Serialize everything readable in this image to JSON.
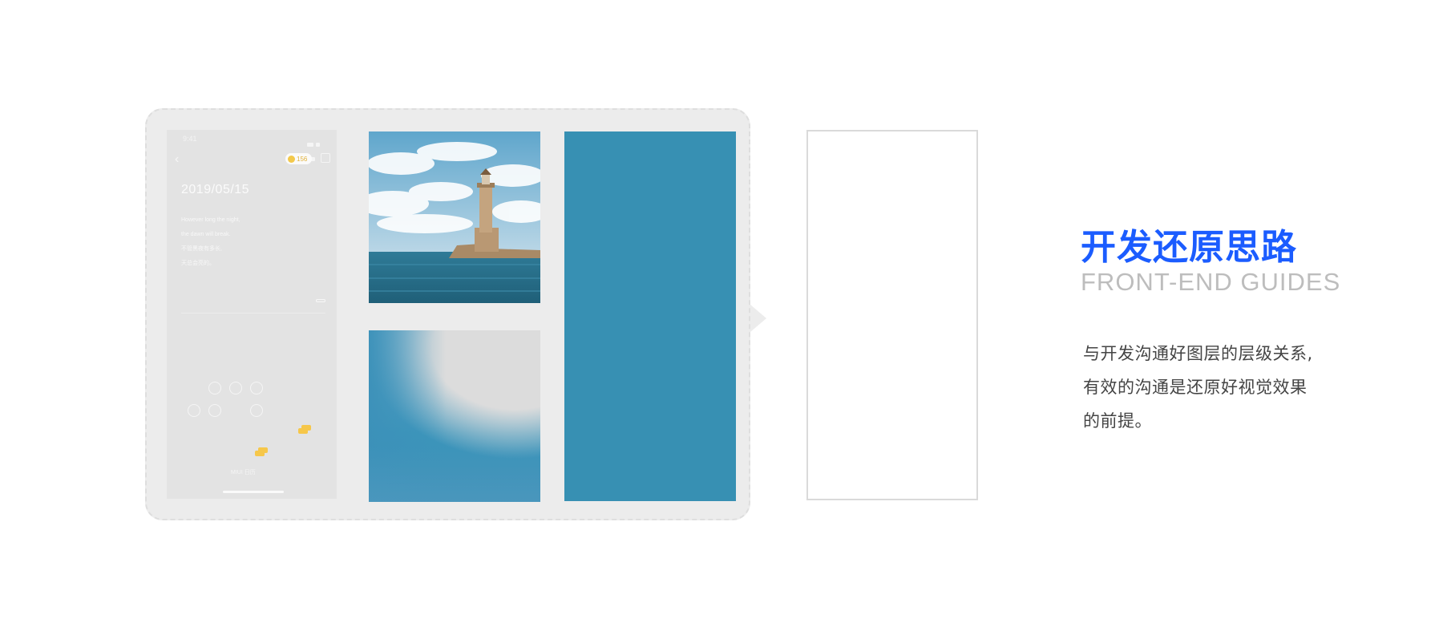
{
  "phone": {
    "time": "9:41",
    "coin_count": "156",
    "date": "2019/05/15",
    "quote_lines": [
      "However long the night,",
      "the dawn will break.",
      "不管黑夜有多长,",
      "天总会亮的。"
    ],
    "footer": "MIUI 日历"
  },
  "photo": {
    "subject": "lighthouse on a stone pier by the sea"
  },
  "colors": {
    "layer_blue": "#3790b3",
    "title_blue": "#1b5cff",
    "board_gray": "#ececec"
  },
  "heading": {
    "title": "开发还原思路",
    "subtitle": "FRONT-END GUIDES"
  },
  "description": {
    "lines": [
      "与开发沟通好图层的层级关系,",
      "有效的沟通是还原好视觉效果",
      "的前提。"
    ]
  }
}
